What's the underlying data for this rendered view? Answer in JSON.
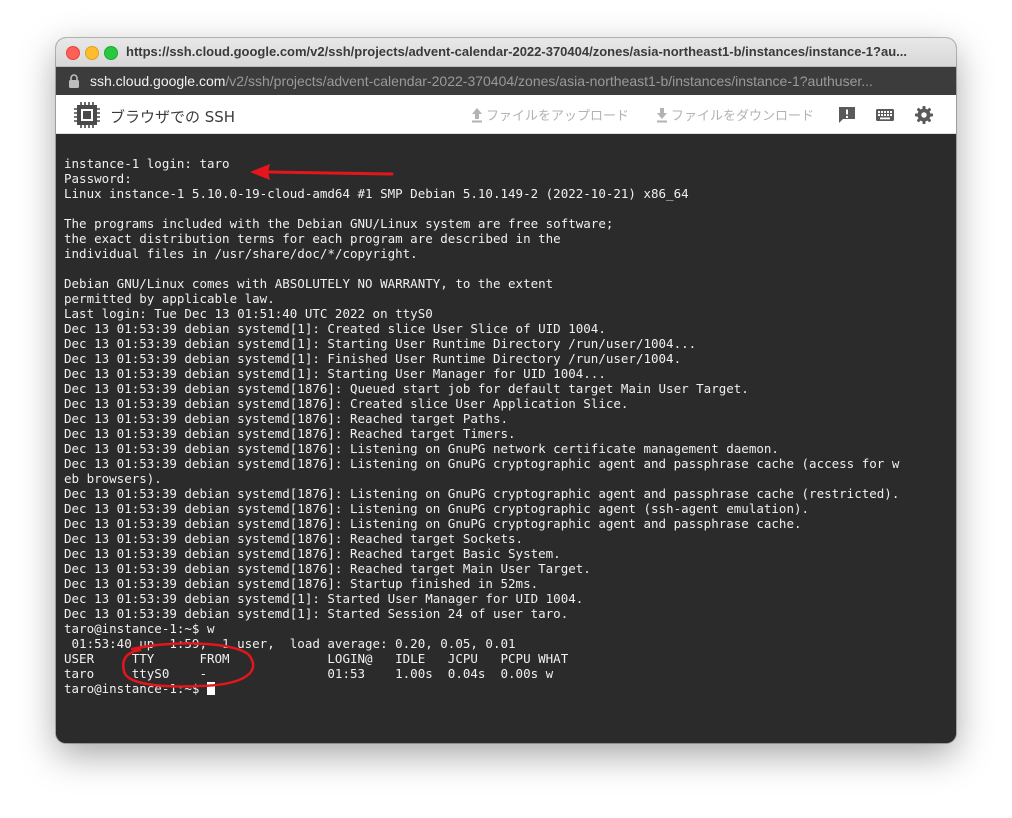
{
  "window": {
    "title": "https://ssh.cloud.google.com/v2/ssh/projects/advent-calendar-2022-370404/zones/asia-northeast1-b/instances/instance-1?au...",
    "url_host": "ssh.cloud.google.com",
    "url_path": "/v2/ssh/projects/advent-calendar-2022-370404/zones/asia-northeast1-b/instances/instance-1?authuser..."
  },
  "toolbar": {
    "app_title": "ブラウザでの SSH",
    "upload_label": "ファイルをアップロード",
    "download_label": "ファイルをダウンロード"
  },
  "icons": {
    "app": "chip-icon",
    "upload": "upload-arrow-icon",
    "download": "download-arrow-icon",
    "feedback": "feedback-icon",
    "keyboard": "keyboard-icon",
    "settings": "gear-icon",
    "lock": "lock-icon"
  },
  "colors": {
    "terminal_bg": "#2b2b2b",
    "terminal_fg": "#f0f0f0",
    "annotation": "#e4161b"
  },
  "terminal": {
    "lines": [
      "instance-1 login: taro",
      "Password:",
      "Linux instance-1 5.10.0-19-cloud-amd64 #1 SMP Debian 5.10.149-2 (2022-10-21) x86_64",
      "",
      "The programs included with the Debian GNU/Linux system are free software;",
      "the exact distribution terms for each program are described in the",
      "individual files in /usr/share/doc/*/copyright.",
      "",
      "Debian GNU/Linux comes with ABSOLUTELY NO WARRANTY, to the extent",
      "permitted by applicable law.",
      "Last login: Tue Dec 13 01:51:40 UTC 2022 on ttyS0",
      "Dec 13 01:53:39 debian systemd[1]: Created slice User Slice of UID 1004.",
      "Dec 13 01:53:39 debian systemd[1]: Starting User Runtime Directory /run/user/1004...",
      "Dec 13 01:53:39 debian systemd[1]: Finished User Runtime Directory /run/user/1004.",
      "Dec 13 01:53:39 debian systemd[1]: Starting User Manager for UID 1004...",
      "Dec 13 01:53:39 debian systemd[1876]: Queued start job for default target Main User Target.",
      "Dec 13 01:53:39 debian systemd[1876]: Created slice User Application Slice.",
      "Dec 13 01:53:39 debian systemd[1876]: Reached target Paths.",
      "Dec 13 01:53:39 debian systemd[1876]: Reached target Timers.",
      "Dec 13 01:53:39 debian systemd[1876]: Listening on GnuPG network certificate management daemon.",
      "Dec 13 01:53:39 debian systemd[1876]: Listening on GnuPG cryptographic agent and passphrase cache (access for w",
      "eb browsers).",
      "Dec 13 01:53:39 debian systemd[1876]: Listening on GnuPG cryptographic agent and passphrase cache (restricted).",
      "Dec 13 01:53:39 debian systemd[1876]: Listening on GnuPG cryptographic agent (ssh-agent emulation).",
      "Dec 13 01:53:39 debian systemd[1876]: Listening on GnuPG cryptographic agent and passphrase cache.",
      "Dec 13 01:53:39 debian systemd[1876]: Reached target Sockets.",
      "Dec 13 01:53:39 debian systemd[1876]: Reached target Basic System.",
      "Dec 13 01:53:39 debian systemd[1876]: Reached target Main User Target.",
      "Dec 13 01:53:39 debian systemd[1876]: Startup finished in 52ms.",
      "Dec 13 01:53:39 debian systemd[1]: Started User Manager for UID 1004.",
      "Dec 13 01:53:39 debian systemd[1]: Started Session 24 of user taro.",
      "taro@instance-1:~$ w",
      " 01:53:40 up  1:59,  1 user,  load average: 0.20, 0.05, 0.01",
      "USER     TTY      FROM             LOGIN@   IDLE   JCPU   PCPU WHAT",
      "taro     ttyS0    -                01:53    1.00s  0.04s  0.00s w"
    ],
    "prompt": "taro@instance-1:~$ "
  }
}
